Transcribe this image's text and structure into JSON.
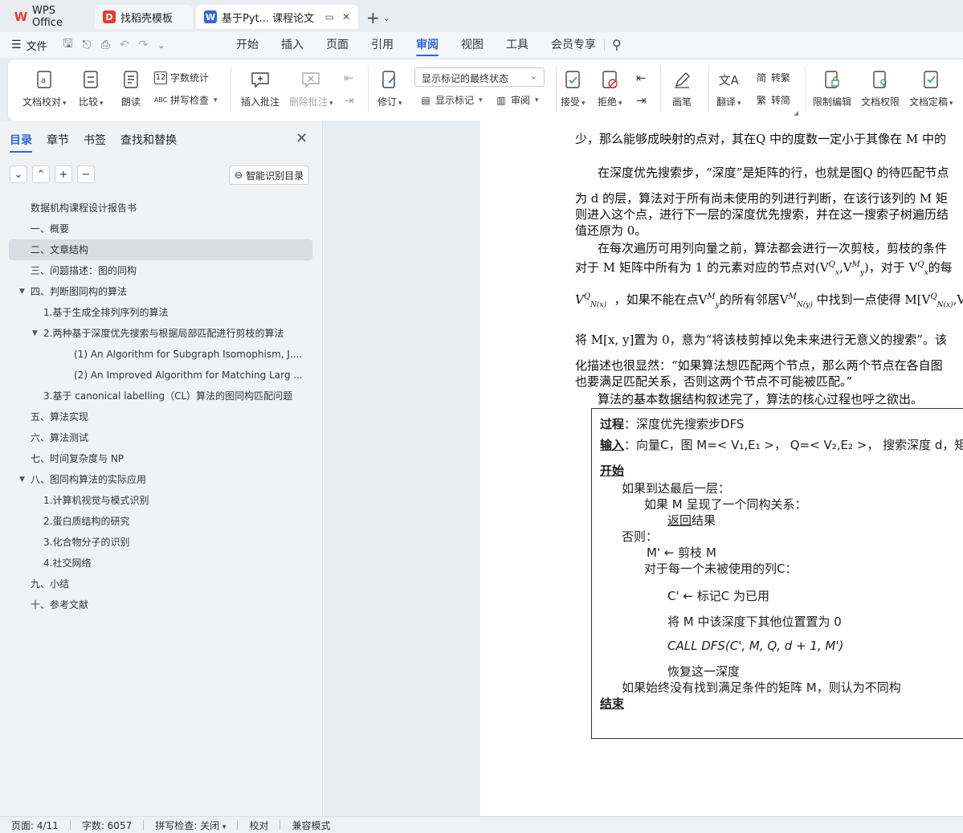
{
  "tabs": {
    "wps": "WPS Office",
    "template": "找稻壳模板",
    "doc": "基于Pyt... 课程论文"
  },
  "menu": {
    "file": "文件",
    "tabs": [
      "开始",
      "插入",
      "页面",
      "引用",
      "审阅",
      "视图",
      "工具",
      "会员专享"
    ],
    "active": "审阅"
  },
  "ribbon": {
    "doc_proof": "文档校对",
    "compare": "比较",
    "read": "朗读",
    "word_count": "字数统计",
    "spell_check": "拼写检查",
    "insert_comment": "插入批注",
    "delete_comment": "删除批注",
    "revise": "修订",
    "markup_state": "显示标记的最终状态",
    "show_markup": "显示标记",
    "review": "审阅",
    "accept": "接受",
    "reject": "拒绝",
    "pen": "画笔",
    "translate": "翻译",
    "to_traditional": "转繁",
    "to_simplified": "转简",
    "restrict_edit": "限制编辑",
    "doc_permission": "文档权限",
    "doc_finalize": "文档定稿"
  },
  "nav": {
    "tabs": [
      "目录",
      "章节",
      "书签",
      "查找和替换"
    ],
    "smart_toc": "智能识别目录",
    "toc": [
      {
        "label": "数据机构课程设计报告书",
        "level": 0
      },
      {
        "label": "一、概要",
        "level": 0
      },
      {
        "label": "二、文章结构",
        "level": 0,
        "selected": true
      },
      {
        "label": "三、问题描述：图的同构",
        "level": 0
      },
      {
        "label": "四、判断图同构的算法",
        "level": 0,
        "expanded": true
      },
      {
        "label": "1.基于生成全排列序列的算法",
        "level": 1
      },
      {
        "label": "2.两种基于深度优先搜索与根据局部匹配进行剪枝的算法",
        "level": 1,
        "expanded": true
      },
      {
        "label": "(1)   An Algorithm for Subgraph Isomophism, J....",
        "level": 2
      },
      {
        "label": "(2)   An Improved Algorithm for Matching Larg ...",
        "level": 2
      },
      {
        "label": "3.基于 canonical labelling（CL）算法的图同构匹配问题",
        "level": 1
      },
      {
        "label": "五、算法实现",
        "level": 0
      },
      {
        "label": "六、算法测试",
        "level": 0
      },
      {
        "label": "七、时间复杂度与 NP",
        "level": 0
      },
      {
        "label": "八、图同构算法的实际应用",
        "level": 0,
        "expanded": true
      },
      {
        "label": "1.计算机视觉与模式识别",
        "level": 1
      },
      {
        "label": "2.蛋白质结构的研究",
        "level": 1
      },
      {
        "label": "3.化合物分子的识别",
        "level": 1
      },
      {
        "label": "4.社交网络",
        "level": 1
      },
      {
        "label": "九、小结",
        "level": 0
      },
      {
        "label": "十、参考文献",
        "level": 0
      }
    ]
  },
  "doc": {
    "p1": "少，那么能够成映射的点对，其在Q 中的度数一定小于其像在  M 中的",
    "p2": "在深度优先搜索步，“深度”是矩阵的行，也就是图Q 的待匹配节点",
    "p3": "为 d 的层，算法对于所有尚未使用的列进行判断，在该行该列的  M 矩",
    "p4": "则进入这个点，进行下一层的深度优先搜索，并在这一搜索子树遍历结",
    "p5": "值还原为 0。",
    "p6": "在每次遍历可用列向量之前，算法都会进行一次剪枝，剪枝的条件",
    "p7": "对于  M 矩阵中所有为  1 的元素对应的节点对(V",
    "p7b": ")，对于 V",
    "p7c": "的每",
    "p8": "，如果不能在点V",
    "p8b": "的所有邻居V",
    "p8c": "中找到一点使得  M[V",
    "p9": "将  M[x, y]置为  0，意为“将该枝剪掉以免未来进行无意义的搜索”。该",
    "p10": "化描述也很显然：“如果算法想匹配两个节点，那么两个节点在各自图",
    "p11": "也要满足匹配关系，否则这两个节点不可能被匹配。”",
    "p12": "算法的基本数据结构叙述完了，算法的核心过程也呼之欲出。",
    "algo": {
      "proc_label": "过程",
      "proc": "：深度优先搜索步DFS",
      "input_label": "输入",
      "input": "：向量C，图 M=< V₁,E₁ >， Q=< V₂,E₂ >， 搜索深度 d，矩",
      "begin": "开始",
      "l1": "如果到达最后一层：",
      "l2": "如果  M 呈现了一个同构关系：",
      "l3_a": "返回",
      "l3_b": "结果",
      "l4": "否则：",
      "l5": "M' ← 剪枝  M",
      "l6": "对于每一个未被使用的列C：",
      "l7": "C' ← 标记C 为已用",
      "l8": "将  M 中该深度下其他位置置为   0",
      "l9": "CALL     DFS(C', M, Q, d + 1, M')",
      "l10": "恢复这一深度",
      "l11": "如果始终没有找到满足条件的矩阵  M，则认为不同构",
      "end": "结束"
    }
  },
  "status": {
    "page": "页面: 4/11",
    "words": "字数: 6057",
    "spell": "拼写检查: 关闭",
    "proof": "校对",
    "compat": "兼容模式"
  }
}
